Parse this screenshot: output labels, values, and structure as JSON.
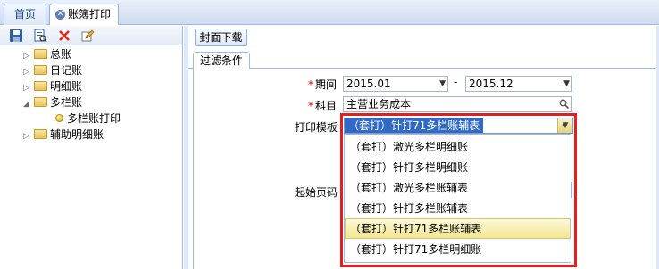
{
  "tabs": [
    {
      "label": "首页"
    },
    {
      "label": "账簿打印"
    }
  ],
  "toolbar": {
    "icons": [
      "save-icon",
      "print-preview-icon",
      "delete-icon",
      "edit-icon"
    ]
  },
  "tree": {
    "items": [
      {
        "label": "总账",
        "expanded": false
      },
      {
        "label": "日记账",
        "expanded": false
      },
      {
        "label": "明细账",
        "expanded": false
      },
      {
        "label": "多栏账",
        "expanded": true
      },
      {
        "label": "多栏账打印",
        "leaf": true
      },
      {
        "label": "辅助明细账",
        "expanded": false
      }
    ]
  },
  "content": {
    "cover_button": "封面下载",
    "filter_tab": "过滤条件",
    "period": {
      "label": "期间",
      "from": "2015.01",
      "separator": "-",
      "to": "2015.12"
    },
    "subject": {
      "label": "科目",
      "value": "主营业务成本"
    },
    "print_template": {
      "label": "打印模板",
      "selected": "（套打）针打71多栏账辅表",
      "options": [
        "（套打）激光多栏明细账",
        "（套打）针打多栏明细账",
        "（套打）激光多栏账辅表",
        "（套打）针打多栏账辅表",
        "（套打）针打71多栏账辅表",
        "（套打）针打71多栏明细账"
      ],
      "highlighted_index": 4
    },
    "start_page": {
      "label": "起始页码"
    }
  },
  "colors": {
    "accent": "#316ac5",
    "highlight_box": "#e02020",
    "required_star": "#ee0000"
  }
}
